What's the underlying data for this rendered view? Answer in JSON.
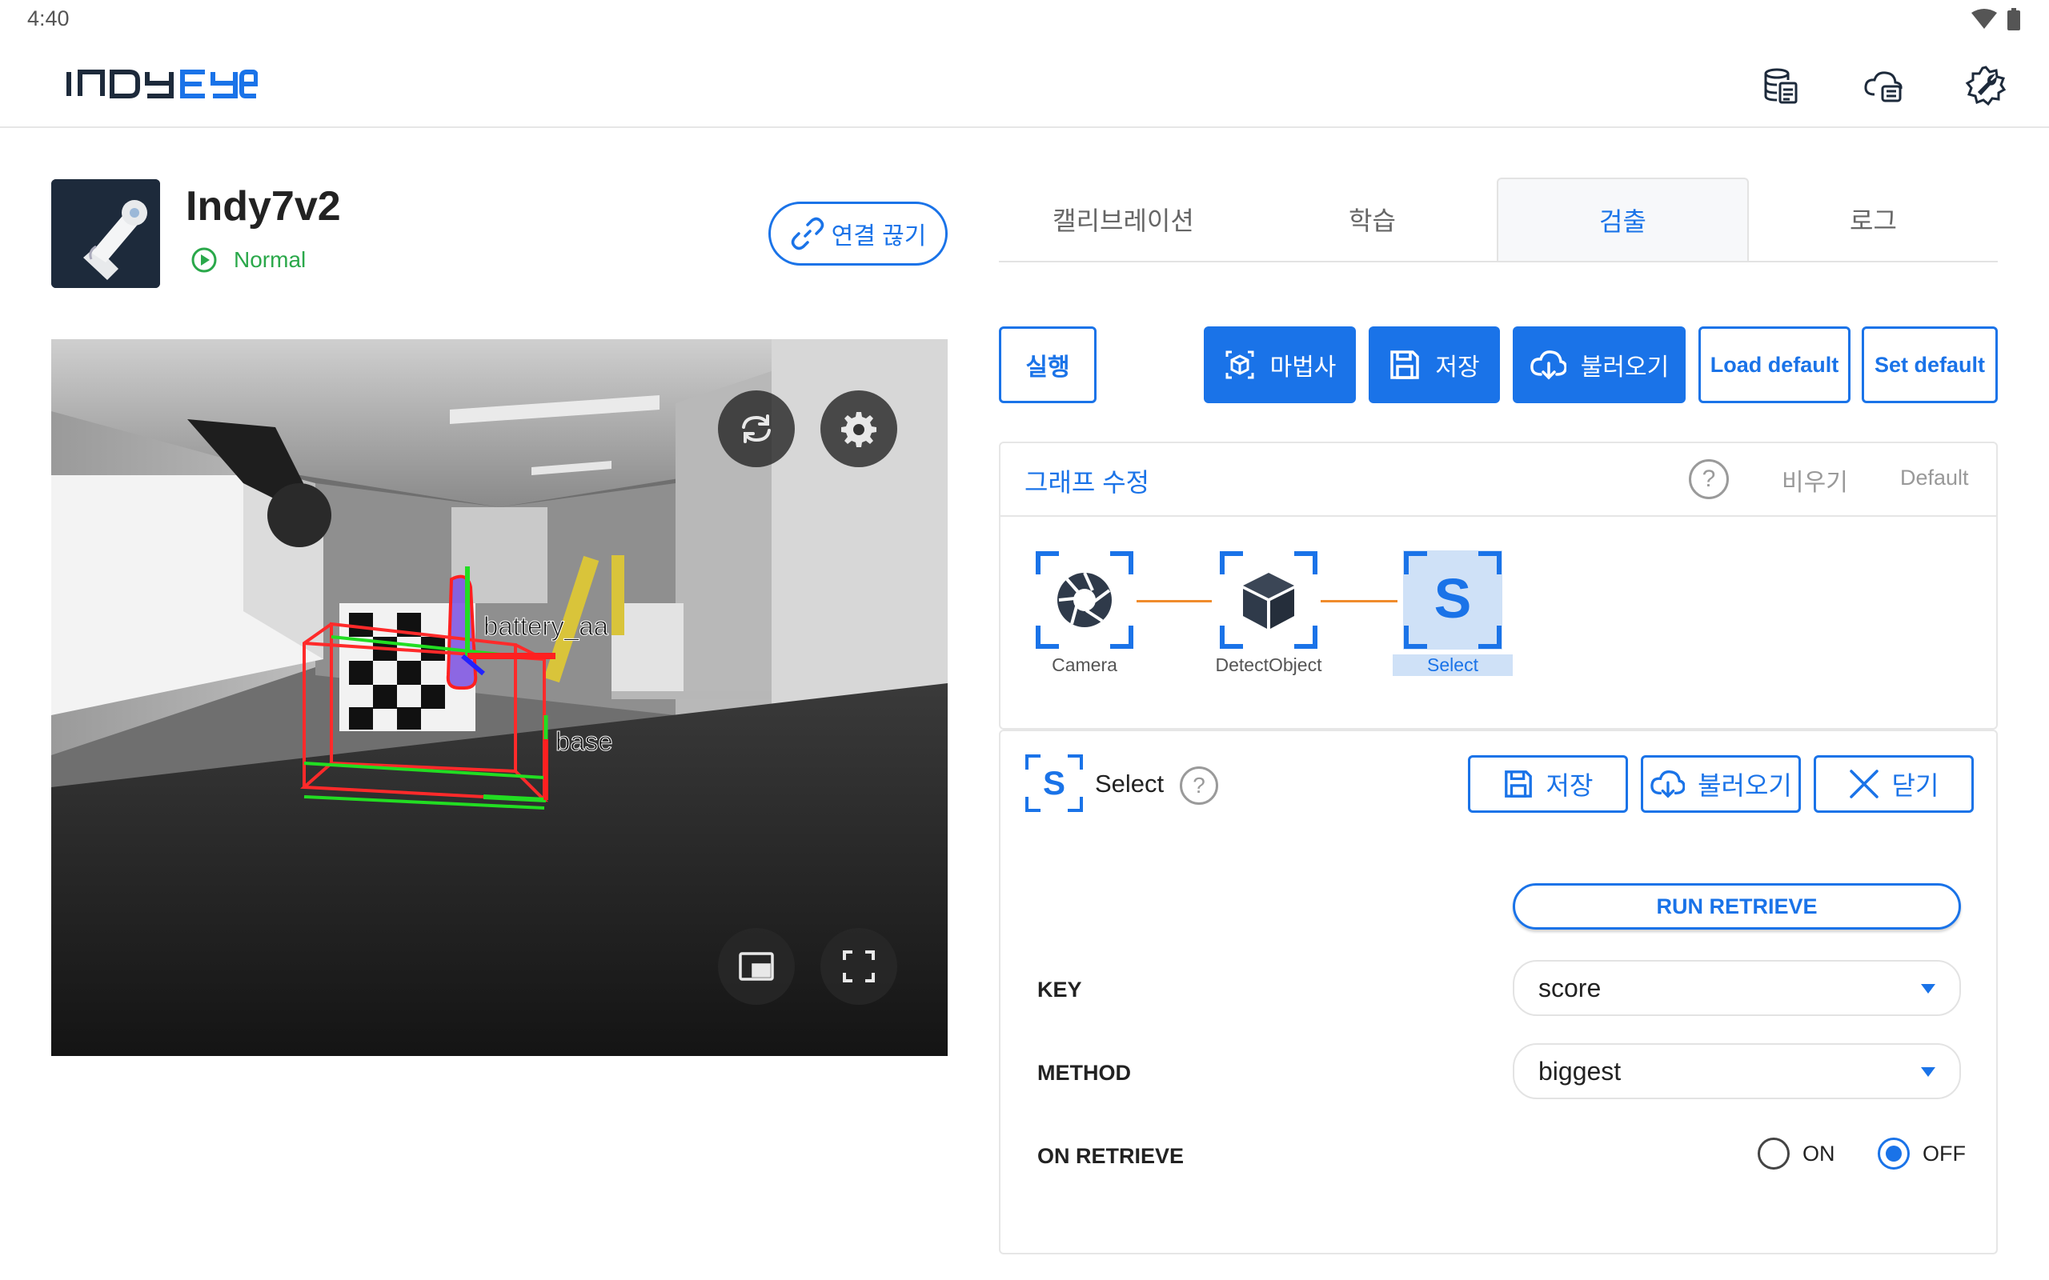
{
  "status_bar": {
    "time": "4:40"
  },
  "header": {
    "logo_text": "INDYEYE",
    "icons": [
      "database-icon",
      "cloud-storage-icon",
      "settings-wrench-icon"
    ]
  },
  "robot": {
    "name": "Indy7v2",
    "status": "Normal",
    "disconnect_label": "연결 끊기"
  },
  "camera": {
    "overlays": {
      "label_object": "battery_aa",
      "label_base": "base"
    },
    "controls": [
      "sync-icon",
      "gear-icon",
      "picture-in-picture-icon",
      "fullscreen-icon"
    ]
  },
  "tabs": [
    {
      "label": "캘리브레이션",
      "active": false
    },
    {
      "label": "학습",
      "active": false
    },
    {
      "label": "검출",
      "active": true
    },
    {
      "label": "로그",
      "active": false
    }
  ],
  "toolbar": {
    "run": "실행",
    "wizard": "마법사",
    "save": "저장",
    "load": "불러오기",
    "load_default": "Load default",
    "set_default": "Set default"
  },
  "graph": {
    "title": "그래프 수정",
    "help": "?",
    "clear": "비우기",
    "default": "Default",
    "nodes": [
      {
        "label": "Camera",
        "icon": "camera-aperture-icon"
      },
      {
        "label": "DetectObject",
        "icon": "cube-icon"
      },
      {
        "label": "Select",
        "icon": "select-s-icon",
        "selected": true
      }
    ]
  },
  "node_panel": {
    "name": "Select",
    "help": "?",
    "save": "저장",
    "load": "불러오기",
    "close": "닫기",
    "run_retrieve": "RUN RETRIEVE",
    "key_label": "KEY",
    "key_value": "score",
    "method_label": "METHOD",
    "method_value": "biggest",
    "on_retrieve_label": "ON RETRIEVE",
    "radio_on": "ON",
    "radio_off": "OFF",
    "on_retrieve_selected": "OFF"
  },
  "colors": {
    "accent": "#1a73e8",
    "status_ok": "#2aa84a",
    "edge": "#f08c2c"
  }
}
